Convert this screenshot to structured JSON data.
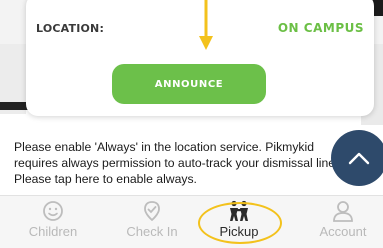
{
  "card": {
    "location_label": "LOCATION:",
    "location_value": "ON CAMPUS",
    "announce_label": "ANNOUNCE"
  },
  "notice": {
    "text": "Please enable 'Always' in the location service. Pikmykid requires always permission to auto-track your dismissal line. Please tap here to enable always."
  },
  "tabs": [
    {
      "label": "Children",
      "icon": "children-icon",
      "active": false
    },
    {
      "label": "Check In",
      "icon": "check-in-icon",
      "active": false
    },
    {
      "label": "Pickup",
      "icon": "pickup-icon",
      "active": true
    },
    {
      "label": "Account",
      "icon": "account-icon",
      "active": false
    }
  ],
  "colors": {
    "accent_green": "#6cc04a",
    "status_green": "#6bbf45",
    "highlight_yellow": "#f3c21c",
    "scroll_button": "#2e4a6b"
  }
}
